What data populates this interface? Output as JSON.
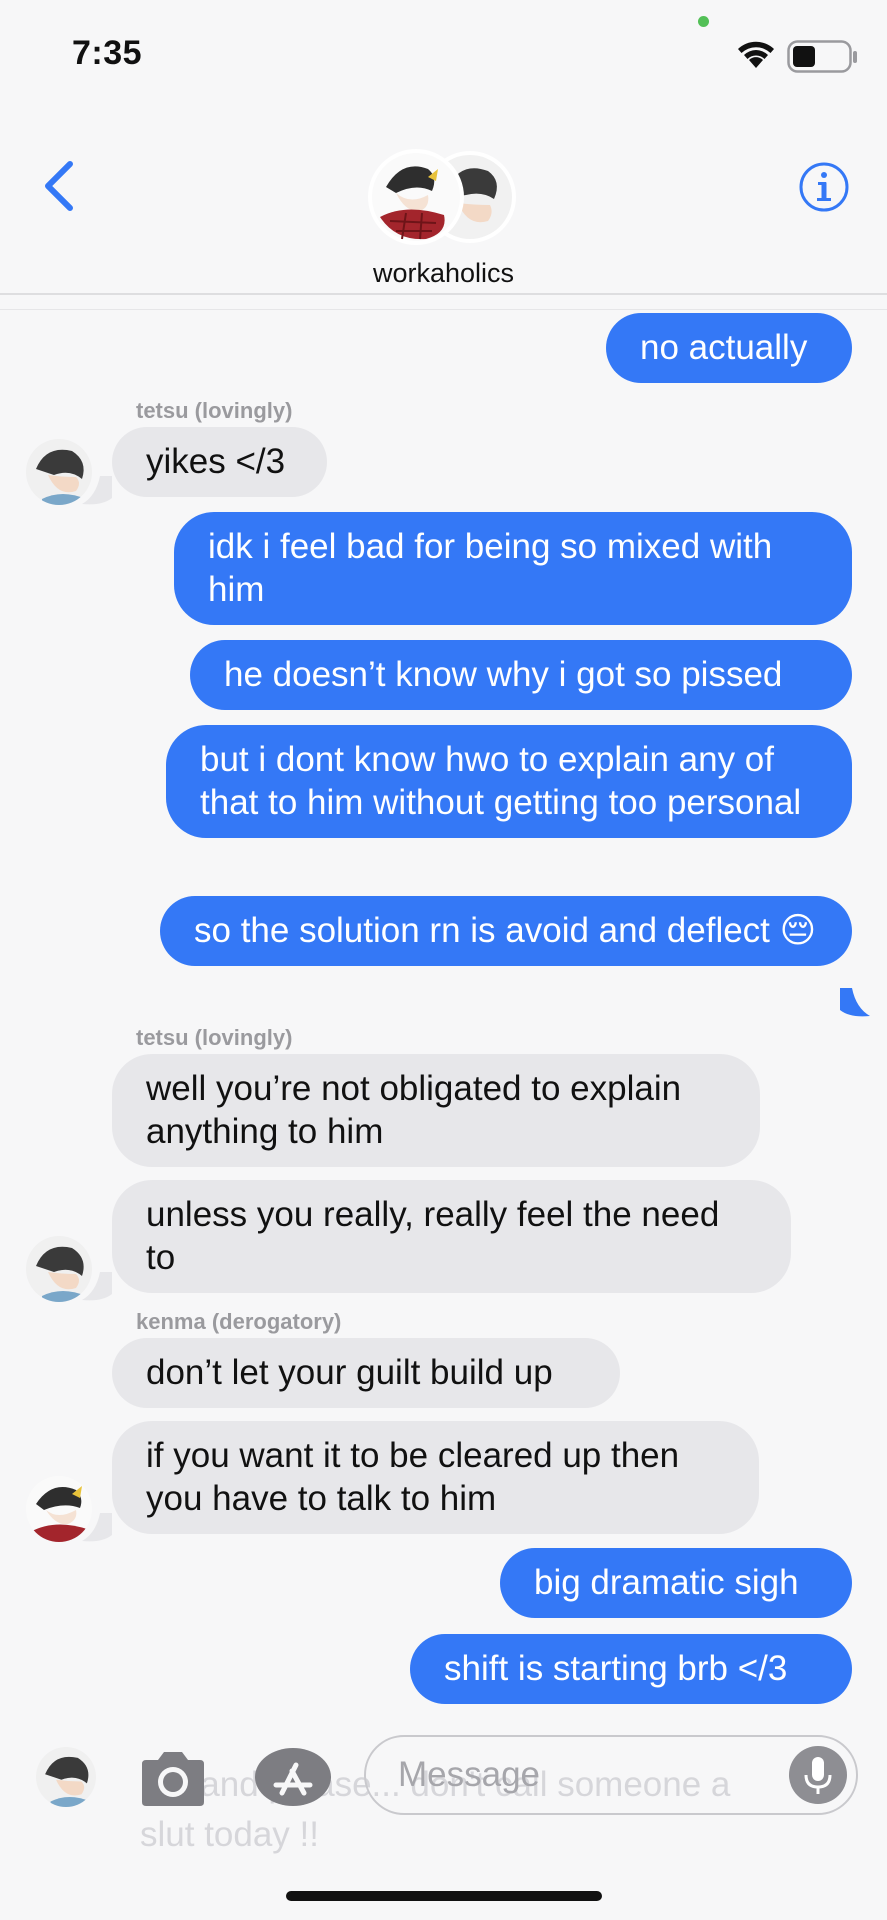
{
  "status": {
    "time": "7:35"
  },
  "header": {
    "group_name": "workaholics"
  },
  "messages": [
    {
      "sender": "",
      "text": "no actually"
    },
    {
      "sender": "tetsu (lovingly)",
      "text": "yikes </3"
    },
    {
      "sender": "",
      "text": "idk i feel bad for being so mixed with him"
    },
    {
      "sender": "",
      "text": "he doesn’t know why i got so pissed"
    },
    {
      "sender": "",
      "text": "but i dont know hwo to explain any of that to him without getting too personal"
    },
    {
      "sender": "",
      "text": "so the solution rn is avoid and deflect 😔"
    },
    {
      "sender": "tetsu (lovingly)",
      "text": "well you’re not obligated to explain anything to him"
    },
    {
      "sender": "",
      "text": "unless you really, really feel the need to"
    },
    {
      "sender": "kenma (derogatory)",
      "text": "don’t let your guilt build up"
    },
    {
      "sender": "",
      "text": "if you want it to be cleared up then you have to talk to him"
    },
    {
      "sender": "",
      "text": "big dramatic sigh"
    },
    {
      "sender": "",
      "text": "shift is starting brb </3"
    }
  ],
  "composer": {
    "placeholder": "Message",
    "ghost_text": "rt... and please... don't call someone a slut today !!"
  },
  "colors": {
    "outgoing": "#3478f6",
    "incoming": "#e7e7ea",
    "accent": "#3478f6"
  },
  "icons": [
    "back-chevron-icon",
    "info-icon",
    "camera-icon",
    "app-store-icon",
    "microphone-icon",
    "wifi-icon",
    "battery-icon"
  ]
}
